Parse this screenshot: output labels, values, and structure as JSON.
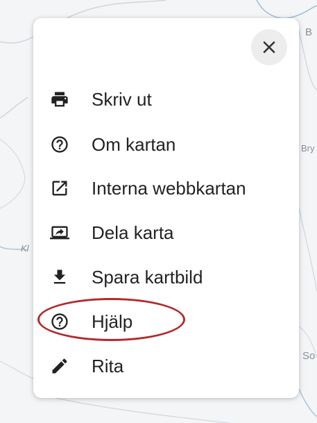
{
  "map": {
    "labels": [
      "B",
      "Bry",
      "Kl",
      "So"
    ]
  },
  "menu": {
    "close_icon": "close-icon",
    "items": [
      {
        "label": "Skriv ut",
        "icon": "printer-icon"
      },
      {
        "label": "Om kartan",
        "icon": "help-circle-icon"
      },
      {
        "label": "Interna webbkartan",
        "icon": "open-in-new-icon"
      },
      {
        "label": "Dela karta",
        "icon": "share-screen-icon"
      },
      {
        "label": "Spara kartbild",
        "icon": "download-icon"
      },
      {
        "label": "Hjälp",
        "icon": "help-circle-icon"
      },
      {
        "label": "Rita",
        "icon": "pencil-icon"
      }
    ]
  },
  "annotation": {
    "highlight_color": "#b22a2a"
  }
}
